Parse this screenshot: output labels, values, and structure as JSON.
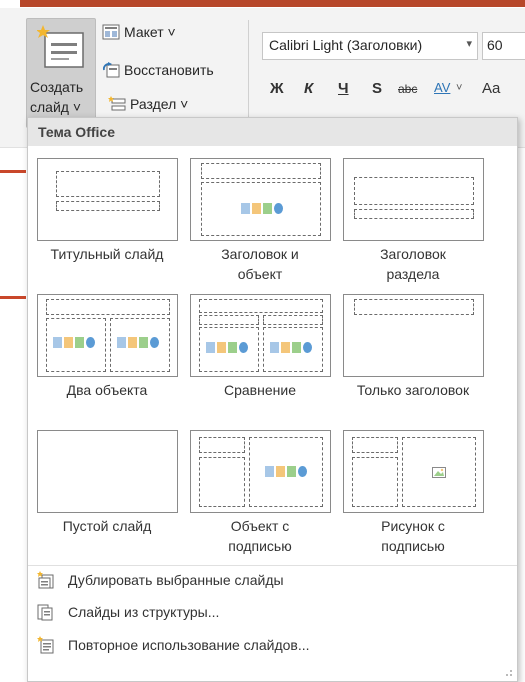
{
  "ribbon": {
    "new_slide_label_line1": "Создать",
    "new_slide_label_line2": "слайд ˅",
    "layout_label": "Макет ˅",
    "reset_label": "Восстановить",
    "section_label": "Раздел ˅",
    "font_name": "Calibri Light (Заголовки)",
    "font_size": "60",
    "bold_glyph": "Ж",
    "italic_glyph": "К",
    "underline_glyph": "Ч",
    "shadow_glyph": "S",
    "strike_glyph": "abc",
    "spacing_glyph": "AV",
    "case_glyph": "Aa"
  },
  "panel": {
    "header": "Тема Office",
    "layouts": [
      {
        "label_line1": "Титульный слайд",
        "label_line2": ""
      },
      {
        "label_line1": "Заголовок и",
        "label_line2": "объект"
      },
      {
        "label_line1": "Заголовок",
        "label_line2": "раздела"
      },
      {
        "label_line1": "Два объекта",
        "label_line2": ""
      },
      {
        "label_line1": "Сравнение",
        "label_line2": ""
      },
      {
        "label_line1": "Только заголовок",
        "label_line2": ""
      },
      {
        "label_line1": "Пустой слайд",
        "label_line2": ""
      },
      {
        "label_line1": "Объект с",
        "label_line2": "подписью"
      },
      {
        "label_line1": "Рисунок с",
        "label_line2": "подписью"
      }
    ],
    "commands": [
      {
        "label": "Дублировать выбранные слайды"
      },
      {
        "label": "Слайды из структуры..."
      },
      {
        "label": "Повторное использование слайдов..."
      }
    ]
  },
  "colors": {
    "accent": "#b7472a",
    "ribbon_bg": "#f3f3f3",
    "selected_button_bg": "#cfcfcf"
  }
}
